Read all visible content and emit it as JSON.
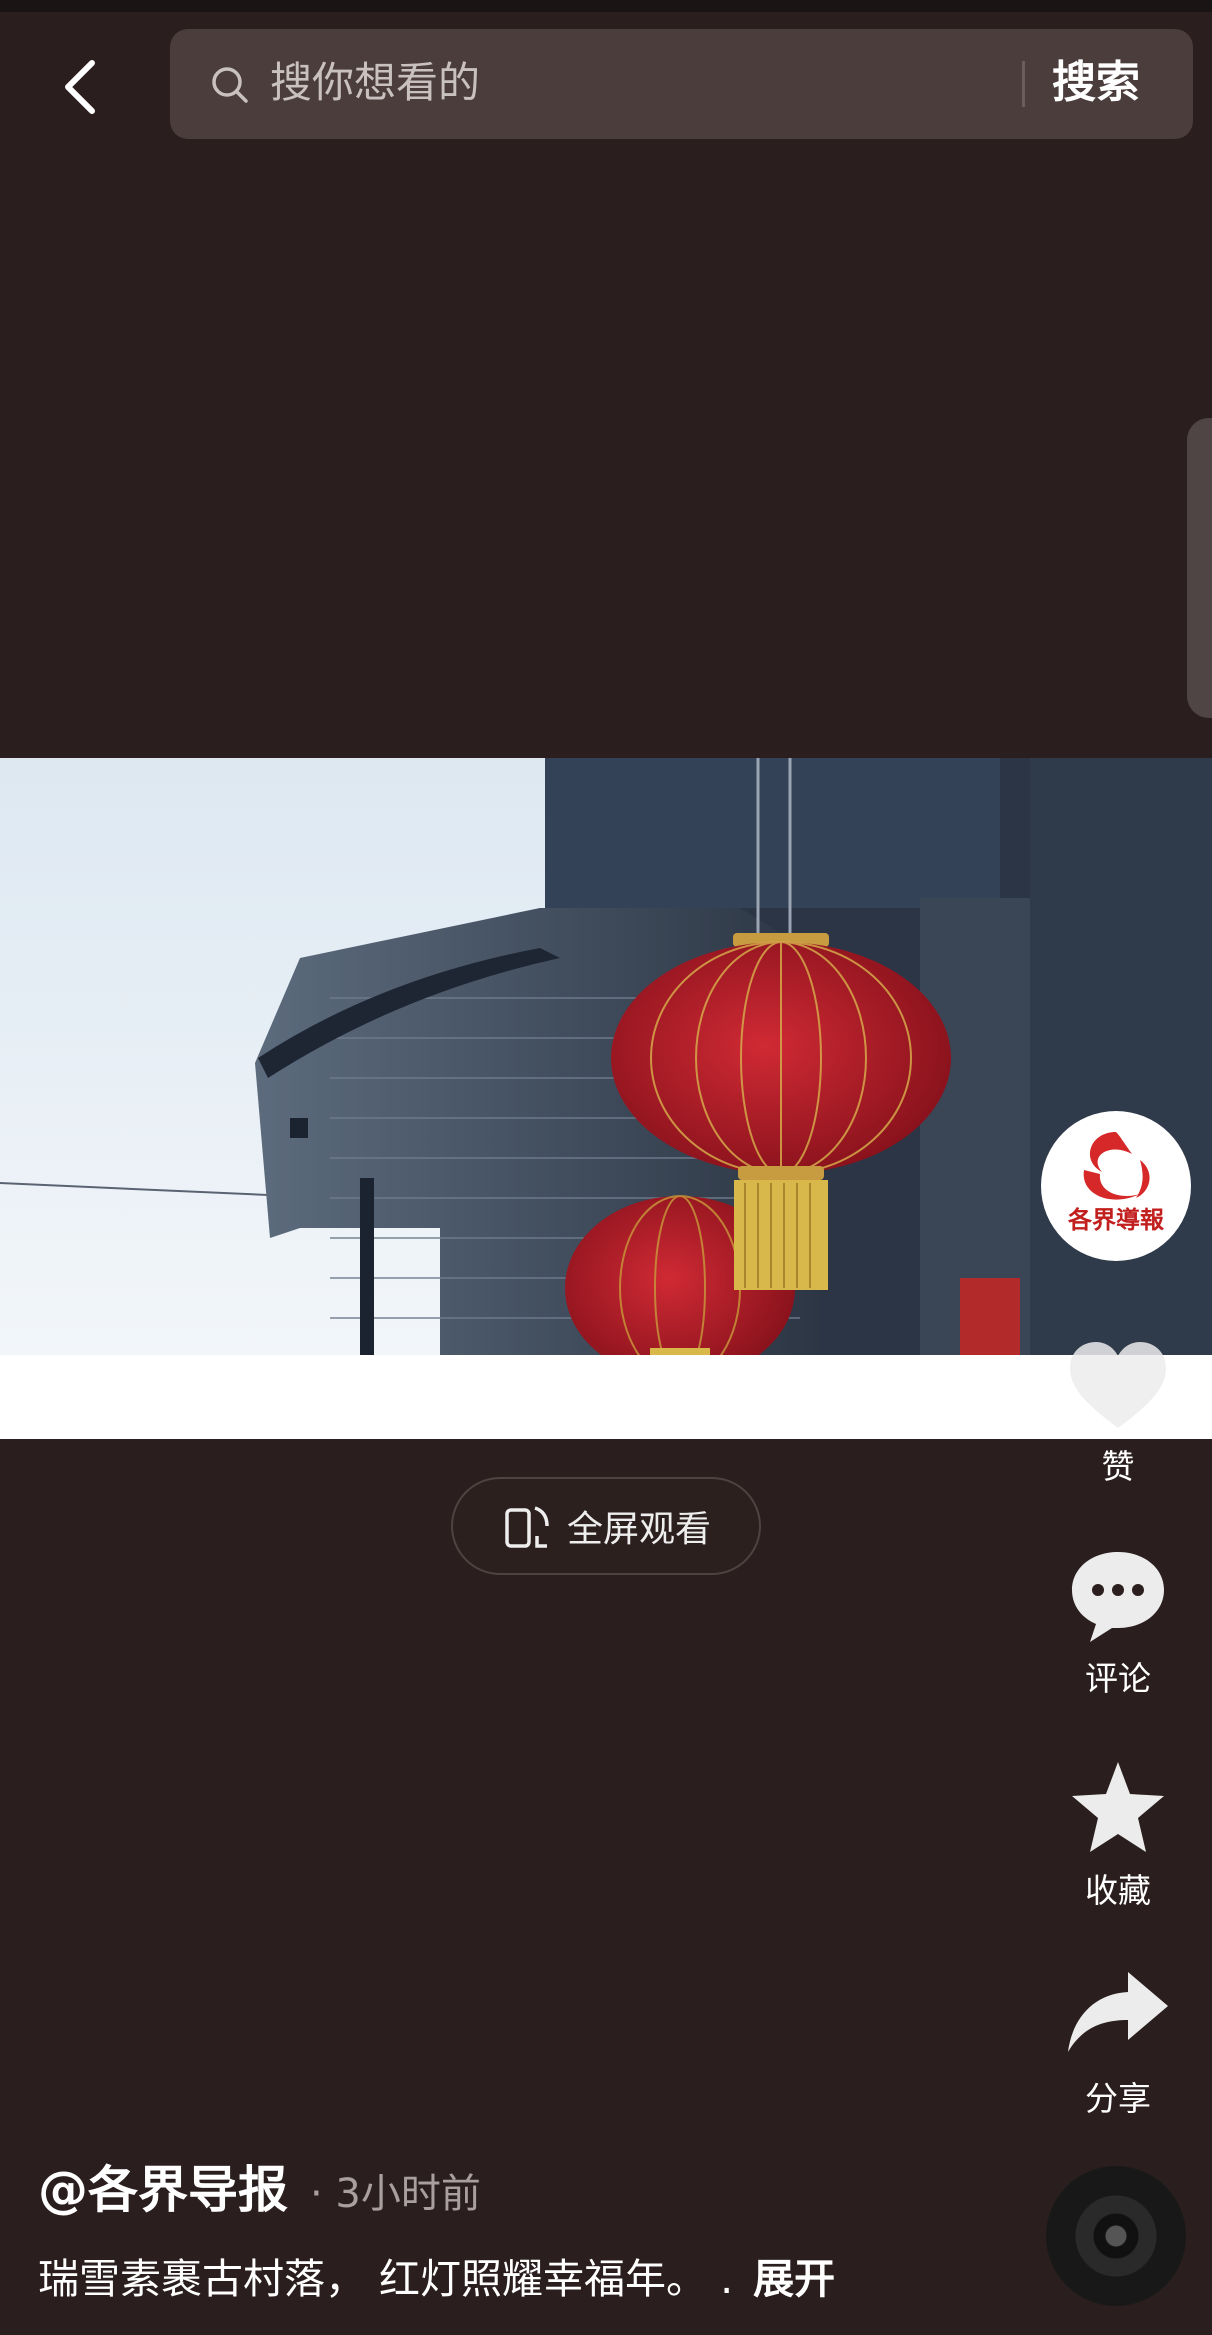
{
  "search": {
    "placeholder": "搜你想看的",
    "button_label": "搜索"
  },
  "video": {
    "logo_text": "各界導報",
    "fullscreen_label": "全屏观看"
  },
  "actions": {
    "like_label": "赞",
    "comment_label": "评论",
    "favorite_label": "收藏",
    "share_label": "分享"
  },
  "post": {
    "author": "@各界导报",
    "time": "· 3小时前",
    "caption": "瑞雪素裹古村落， 红灯照耀幸福年。 .",
    "expand_label": "展开"
  },
  "colors": {
    "background": "#2a1e1e",
    "search_bg": "#4a3d3c",
    "lantern_red": "#b51d2a",
    "tassel_gold": "#d8b84a"
  }
}
